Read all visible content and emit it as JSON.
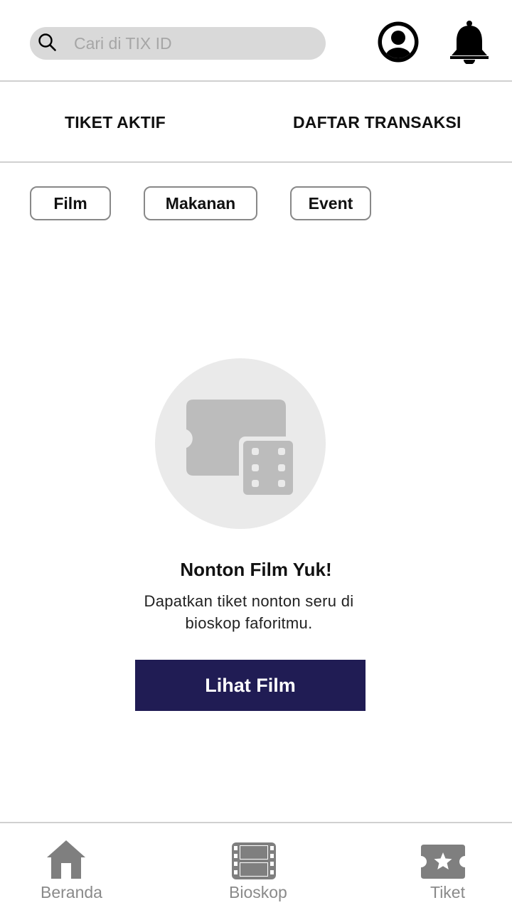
{
  "header": {
    "search": {
      "placeholder": "Cari di TIX ID",
      "value": ""
    },
    "icons": {
      "search": "search-icon",
      "profile": "user-circle-icon",
      "notifications": "bell-icon"
    }
  },
  "tabs": [
    {
      "label": "TIKET AKTIF"
    },
    {
      "label": "DAFTAR TRANSAKSI"
    }
  ],
  "filters": [
    {
      "label": "Film"
    },
    {
      "label": "Makanan"
    },
    {
      "label": "Event"
    }
  ],
  "empty_state": {
    "icon": "ticket-film-icon",
    "title": "Nonton Film Yuk!",
    "description_line1": "Dapatkan tiket nonton seru di",
    "description_line2": "bioskop faforitmu.",
    "button_label": "Lihat Film"
  },
  "bottom_nav": [
    {
      "label": "Beranda",
      "icon": "home-icon"
    },
    {
      "label": "Bioskop",
      "icon": "film-strip-icon"
    },
    {
      "label": "Tiket",
      "icon": "ticket-star-icon"
    }
  ],
  "colors": {
    "primary_button": "#201c54",
    "search_bg": "#d9d9d9",
    "nav_inactive": "#8a8a8a",
    "illustration_bg": "#eaeaea",
    "illustration_fg": "#bcbcbc"
  }
}
